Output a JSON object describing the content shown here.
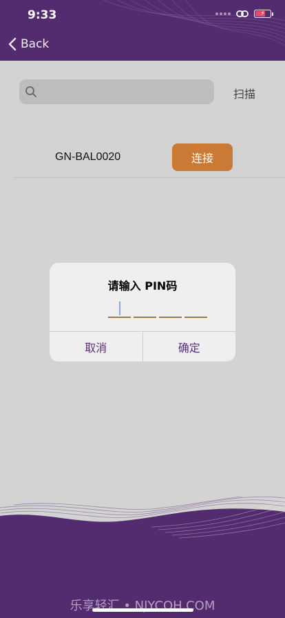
{
  "status_bar": {
    "time": "9:33"
  },
  "nav": {
    "back_label": "Back"
  },
  "search": {
    "placeholder": "",
    "scan_label": "扫描"
  },
  "device": {
    "name": "GN-BAL0020",
    "connect_label": "连接"
  },
  "dialog": {
    "title": "请输入 PIN码",
    "cancel_label": "取消",
    "confirm_label": "确定",
    "pin_slots": 4
  },
  "footer": {
    "text": "乐享轻汇 • NJYCQH.COM"
  },
  "colors": {
    "header": "#532b6f",
    "connect": "#c97a35",
    "background": "#d3d3d3",
    "dialog_button": "#5b2c7c"
  }
}
